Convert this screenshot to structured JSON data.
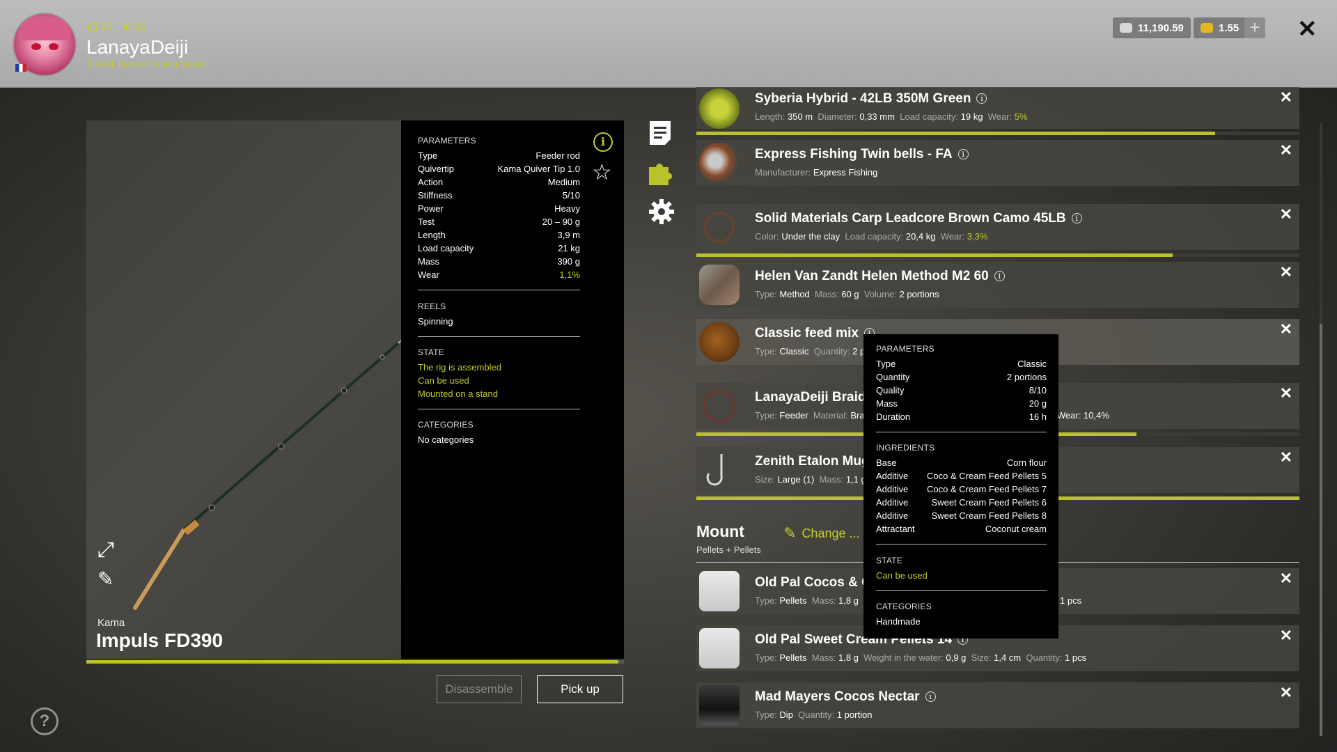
{
  "player": {
    "level": "36",
    "stars": "20",
    "name": "LanayaDeiji",
    "rank": "3 Rank Marine Fishing Master"
  },
  "currency": {
    "silver": "11,190.59",
    "gold": "1.55"
  },
  "rod": {
    "brand": "Kama",
    "model": "Impuls FD390",
    "progress": 0.99,
    "parameters_title": "PARAMETERS",
    "parameters": [
      {
        "k": "Type",
        "v": "Feeder rod"
      },
      {
        "k": "Quivertip",
        "v": "Kama Quiver Tip 1.0"
      },
      {
        "k": "Action",
        "v": "Medium"
      },
      {
        "k": "Stiffness",
        "v": "5/10"
      },
      {
        "k": "Power",
        "v": "Heavy"
      },
      {
        "k": "Test",
        "v": "20 – 90 g"
      },
      {
        "k": "Length",
        "v": "3,9 m"
      },
      {
        "k": "Load capacity",
        "v": "21 kg"
      },
      {
        "k": "Mass",
        "v": "390 g"
      },
      {
        "k": "Wear",
        "v": "1,1%"
      }
    ],
    "reels_title": "REELS",
    "reels": "Spinning",
    "state_title": "STATE",
    "state": [
      "The rig is assembled",
      "Can be used",
      "Mounted on a stand"
    ],
    "categories_title": "CATEGORIES",
    "categories": "No categories"
  },
  "buttons": {
    "disassemble": "Disassemble",
    "pickup": "Pick up"
  },
  "items": [
    {
      "title": "Syberia Hybrid - 42LB 350M Green",
      "sub": [
        [
          "Length:",
          "350 m"
        ],
        [
          "Diameter:",
          "0,33 mm"
        ],
        [
          "Load capacity:",
          "19 kg"
        ],
        [
          "Wear:",
          "5%"
        ]
      ]
    },
    {
      "title": "Express Fishing Twin bells - FA",
      "sub": [
        [
          "Manufacturer:",
          "Express Fishing"
        ]
      ]
    },
    {
      "title": "Solid Materials Carp Leadcore Brown Camo 45LB",
      "sub": [
        [
          "Color:",
          "Under the clay"
        ],
        [
          "Load capacity:",
          "20,4 kg"
        ],
        [
          "Wear:",
          "3,3%"
        ]
      ]
    },
    {
      "title": "Helen Van Zandt Helen Method M2 60",
      "sub": [
        [
          "Type:",
          "Method"
        ],
        [
          "Mass:",
          "60 g"
        ],
        [
          "Volume:",
          "2 portions"
        ]
      ]
    },
    {
      "title": "Classic feed mix",
      "sub": [
        [
          "Type:",
          "Classic"
        ],
        [
          "Quantity:",
          "2 p"
        ]
      ]
    },
    {
      "title": "LanayaDeiji Braide",
      "sub": [
        [
          "Type:",
          "Feeder"
        ],
        [
          "Material:",
          "Bra"
        ]
      ],
      "sub_right": "Wear: 10,4%"
    },
    {
      "title": "Zenith Etalon Mug",
      "sub": [
        [
          "Size:",
          "Large (1)"
        ],
        [
          "Mass:",
          "1,1 g"
        ]
      ]
    }
  ],
  "mount": {
    "title": "Mount",
    "subtitle": "Pellets + Pellets",
    "change": "Change ..."
  },
  "mount_items": [
    {
      "title": "Old Pal Cocos & Cr",
      "sub": [
        [
          "Type:",
          "Pellets"
        ],
        [
          "Mass:",
          "1,8 g"
        ],
        [
          "W",
          ""
        ]
      ],
      "sub_right": "1 pcs"
    },
    {
      "title": "Old Pal Sweet Cream Pellets 14",
      "sub": [
        [
          "Type:",
          "Pellets"
        ],
        [
          "Mass:",
          "1,8 g"
        ],
        [
          "Weight in the water:",
          "0,9 g"
        ],
        [
          "Size:",
          "1,4 cm"
        ],
        [
          "Quantity:",
          "1 pcs"
        ]
      ]
    },
    {
      "title": "Mad Mayers Cocos Nectar",
      "sub": [
        [
          "Type:",
          "Dip"
        ],
        [
          "Quantity:",
          "1 portion"
        ]
      ]
    }
  ],
  "tooltip": {
    "parameters_title": "PARAMETERS",
    "parameters": [
      {
        "k": "Type",
        "v": "Classic"
      },
      {
        "k": "Quantity",
        "v": "2 portions"
      },
      {
        "k": "Quality",
        "v": "8/10"
      },
      {
        "k": "Mass",
        "v": "20 g"
      },
      {
        "k": "Duration",
        "v": "16 h"
      }
    ],
    "ingredients_title": "INGREDIENTS",
    "ingredients": [
      {
        "k": "Base",
        "v": "Corn flour"
      },
      {
        "k": "Additive",
        "v": "Coco & Cream Feed Pellets 5"
      },
      {
        "k": "Additive",
        "v": "Coco & Cream Feed Pellets 7"
      },
      {
        "k": "Additive",
        "v": "Sweet Cream Feed Pellets 6"
      },
      {
        "k": "Additive",
        "v": "Sweet Cream Feed Pellets 8"
      },
      {
        "k": "Attractant",
        "v": "Coconut cream"
      }
    ],
    "state_title": "STATE",
    "state": "Can be used",
    "categories_title": "CATEGORIES",
    "categories": "Handmade"
  },
  "colors": {
    "accent": "#c4cd2d",
    "panel": "#000000",
    "header": "#b3b3b3"
  },
  "icons": [
    "notes-icon",
    "puzzle-icon",
    "gear-icon",
    "info-icon",
    "star-icon",
    "expand-icon",
    "brush-icon",
    "help-icon",
    "close-icon",
    "plus-icon"
  ]
}
